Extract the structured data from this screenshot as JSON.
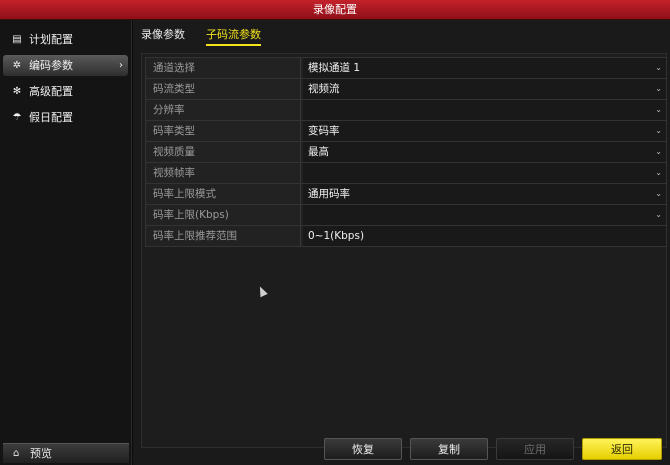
{
  "window": {
    "title": "录像配置"
  },
  "sidebar": {
    "items": [
      {
        "label": "计划配置",
        "icon": "calendar-icon",
        "glyph": "▤"
      },
      {
        "label": "编码参数",
        "icon": "gear-icon",
        "glyph": "✲",
        "chevron": "›"
      },
      {
        "label": "高级配置",
        "icon": "settings-icon",
        "glyph": "✻"
      },
      {
        "label": "假日配置",
        "icon": "umbrella-icon",
        "glyph": "☂"
      }
    ],
    "preview": {
      "label": "预览",
      "icon": "home-icon",
      "glyph": "⌂"
    }
  },
  "tabs": [
    {
      "label": "录像参数"
    },
    {
      "label": "子码流参数"
    }
  ],
  "form": {
    "rows": [
      {
        "label": "通道选择",
        "value": "模拟通道 1",
        "dropdown": true
      },
      {
        "label": "码流类型",
        "value": "视频流",
        "dropdown": true
      },
      {
        "label": "分辨率",
        "value": "",
        "dropdown": true
      },
      {
        "label": "码率类型",
        "value": "变码率",
        "dropdown": true
      },
      {
        "label": "视频质量",
        "value": "最高",
        "dropdown": true
      },
      {
        "label": "视频帧率",
        "value": "",
        "dropdown": true
      },
      {
        "label": "码率上限模式",
        "value": "通用码率",
        "dropdown": true
      },
      {
        "label": "码率上限(Kbps)",
        "value": "",
        "dropdown": true
      },
      {
        "label": "码率上限推荐范围",
        "value": "0~1(Kbps)",
        "dropdown": false
      }
    ]
  },
  "buttons": {
    "restore": "恢复",
    "copy": "复制",
    "apply": "应用",
    "back": "返回"
  },
  "colors": {
    "title_bar": "#b51a24",
    "active_tab": "#f3e21c",
    "primary_button": "#f0dc1a"
  }
}
